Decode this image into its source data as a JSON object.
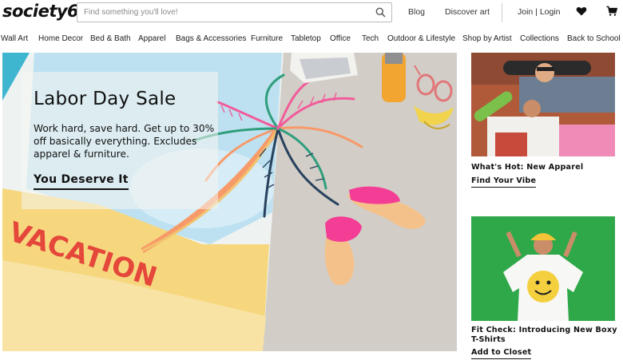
{
  "header": {
    "logo_text": "society6",
    "search_placeholder": "Find something you'll love!",
    "blog_label": "Blog",
    "discover_label": "Discover art",
    "join_login_label": "Join | Login",
    "wishlist_icon": "heart-icon",
    "cart_icon": "cart-icon"
  },
  "nav": {
    "items": [
      {
        "label": "Wall Art"
      },
      {
        "label": "Home Decor"
      },
      {
        "label": "Bed & Bath"
      },
      {
        "label": "Apparel"
      },
      {
        "label": "Bags & Accessories"
      },
      {
        "label": "Furniture"
      },
      {
        "label": "Tabletop"
      },
      {
        "label": "Office"
      },
      {
        "label": "Tech"
      },
      {
        "label": "Outdoor & Lifestyle"
      },
      {
        "label": "Shop by Artist"
      },
      {
        "label": "Collections"
      },
      {
        "label": "Back to School"
      }
    ]
  },
  "hero": {
    "title": "Labor Day Sale",
    "body": "Work hard, save hard. Get up to 30% off basically everything. Excludes apparel & furniture.",
    "cta_label": "You Deserve It",
    "towel_text": "VACATION"
  },
  "cards": [
    {
      "title": "What's Hot: New Apparel",
      "link_label": "Find Your Vibe"
    },
    {
      "title": "Fit Check: Introducing New Boxy T-Shirts",
      "link_label": "Add to Closet"
    }
  ],
  "colors": {
    "text": "#111111",
    "towel_pink": "#f25b9a",
    "towel_blue": "#b9dff0",
    "towel_yellow": "#f4d47a",
    "card2_green": "#2fa84a"
  }
}
